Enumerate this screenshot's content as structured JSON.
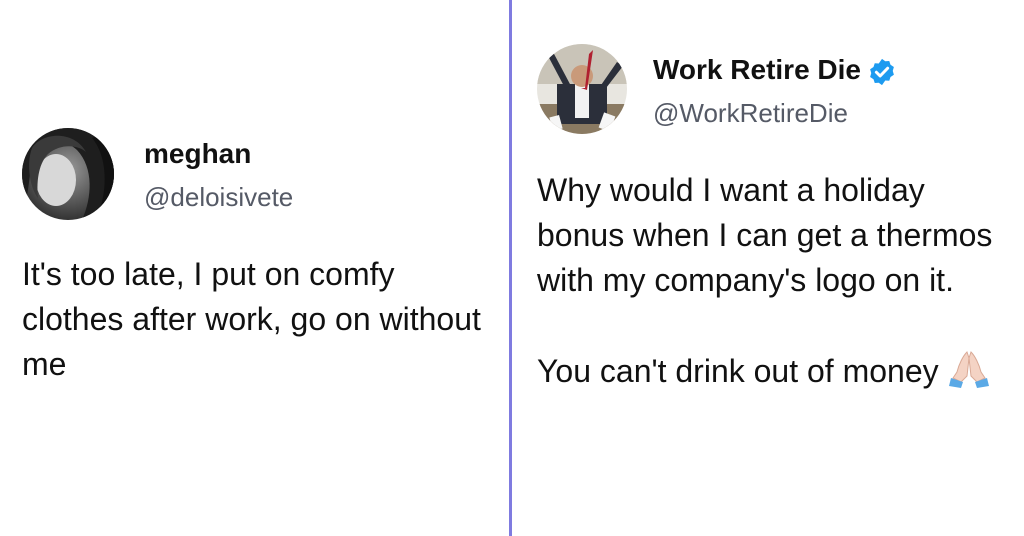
{
  "tweets": [
    {
      "display_name": "meghan",
      "handle": "@deloisivete",
      "verified": false,
      "avatar_icon": "profile-photo",
      "text": "It's too late, I put on comfy clothes after work, go on without me"
    },
    {
      "display_name": "Work Retire Die",
      "handle": "@WorkRetireDie",
      "verified": true,
      "avatar_icon": "profile-photo",
      "text_para1": "Why would I want a holiday bonus when I can get a thermos with my company's logo on it.",
      "text_para2": "You can't drink out of money",
      "emoji_icon": "folded-hands-icon"
    }
  ],
  "colors": {
    "divider": "#7f7be0",
    "verified_badge": "#1d9bf0",
    "handle": "#555a66"
  }
}
